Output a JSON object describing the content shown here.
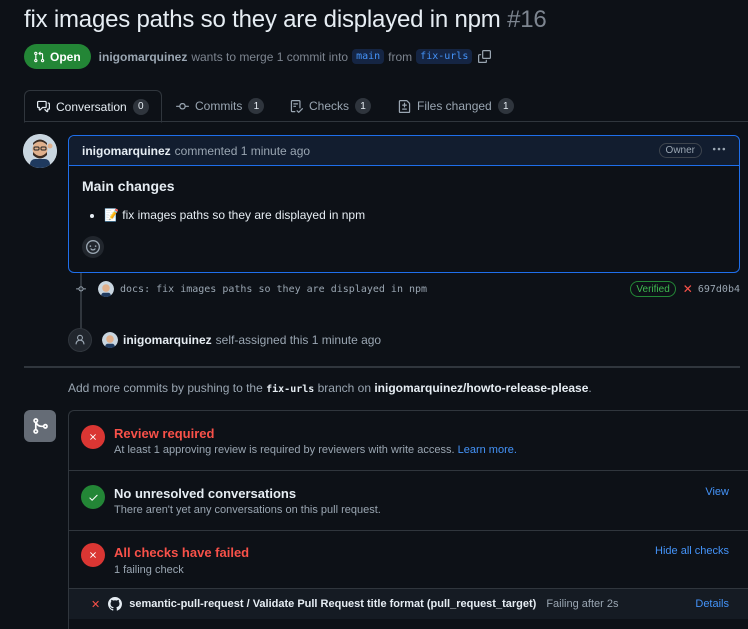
{
  "pr": {
    "title": "fix images paths so they are displayed in npm",
    "number": "#16",
    "state": "Open",
    "author": "inigomarquinez",
    "merge_text": "wants to merge 1 commit into",
    "base_branch": "main",
    "from_text": "from",
    "head_branch": "fix-urls"
  },
  "tabs": [
    {
      "label": "Conversation",
      "count": "0"
    },
    {
      "label": "Commits",
      "count": "1"
    },
    {
      "label": "Checks",
      "count": "1"
    },
    {
      "label": "Files changed",
      "count": "1"
    }
  ],
  "comment": {
    "author": "inigomarquinez",
    "action": "commented 1 minute ago",
    "badge": "Owner",
    "heading": "Main changes",
    "bullet_emoji": "📝",
    "bullet_text": "fix images paths so they are displayed in npm"
  },
  "commit": {
    "message": "docs: fix images paths so they are displayed in npm",
    "verified": "Verified",
    "sha": "697d0b4"
  },
  "assign": {
    "author": "inigomarquinez",
    "action": "self-assigned this 1 minute ago"
  },
  "add_more": {
    "prefix": "Add more commits by pushing to the",
    "branch": "fix-urls",
    "middle": "branch on",
    "repo": "inigomarquinez/howto-release-please",
    "suffix": "."
  },
  "merge": {
    "review_title": "Review required",
    "review_sub": "At least 1 approving review is required by reviewers with write access.",
    "review_link": "Learn more.",
    "conv_title": "No unresolved conversations",
    "conv_sub": "There aren't yet any conversations on this pull request.",
    "conv_link": "View",
    "checks_title": "All checks have failed",
    "checks_sub": "1 failing check",
    "checks_link": "Hide all checks",
    "check_name": "semantic-pull-request / Validate Pull Request title format (pull_request_target)",
    "check_status": "Failing after 2s",
    "check_details": "Details"
  },
  "colors": {
    "background": "#0d1117",
    "open_green": "#238636",
    "error_red": "#da3633",
    "link_blue": "#4493f8",
    "border": "#30363d"
  },
  "icons": [
    "pull-request-icon",
    "copy-icon",
    "conversation-icon",
    "commit-icon",
    "checks-icon",
    "file-diff-icon",
    "kebab-icon",
    "smiley-icon",
    "person-icon",
    "git-merge-icon",
    "x-icon",
    "check-icon",
    "github-icon"
  ]
}
